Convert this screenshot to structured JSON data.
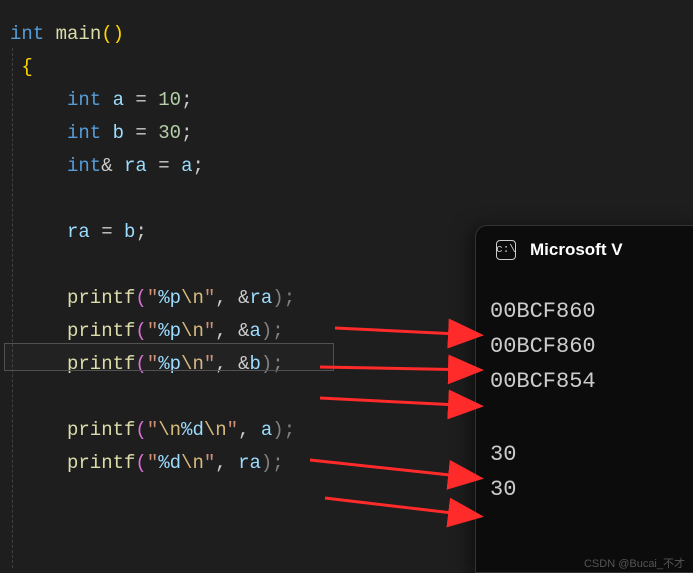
{
  "code": {
    "line1_type": "int",
    "line1_func": "main",
    "line1_p1": "(",
    "line1_p2": ")",
    "line2_brace": "{",
    "line3_type": "int",
    "line3_var": "a",
    "line3_eq": " = ",
    "line3_num": "10",
    "line3_semi": ";",
    "line4_type": "int",
    "line4_var": "b",
    "line4_eq": " = ",
    "line4_num": "30",
    "line4_semi": ";",
    "line5_type": "int",
    "line5_amp": "&",
    "line5_var": "ra",
    "line5_eq": " = ",
    "line5_rhs": "a",
    "line5_semi": ";",
    "line6_var": "ra",
    "line6_eq": " = ",
    "line6_rhs": "b",
    "line6_semi": ";",
    "printf": "printf",
    "p1_fmt_q1": "\"",
    "p1_fmt_pct": "%p",
    "p1_fmt_esc": "\\n",
    "p1_fmt_q2": "\"",
    "comma_sp": ", ",
    "amp": "&",
    "arg_ra": "ra",
    "arg_a": "a",
    "arg_b": "b",
    "p4_fmt_q1": "\"",
    "p4_fmt_esc1": "\\n",
    "p4_fmt_pct": "%d",
    "p4_fmt_esc2": "\\n",
    "p4_fmt_q2": "\"",
    "p5_fmt_q1": "\"",
    "p5_fmt_pct": "%d",
    "p5_fmt_esc": "\\n",
    "p5_fmt_q2": "\"",
    "lparen": "(",
    "rparen": ")",
    "semi": ";"
  },
  "terminal": {
    "title": "Microsoft V",
    "icon_text": "c:\\",
    "out1": "00BCF860",
    "out2": "00BCF860",
    "out3": "00BCF854",
    "out4": "30",
    "out5": "30"
  },
  "watermark": "CSDN @Bucai_不才"
}
